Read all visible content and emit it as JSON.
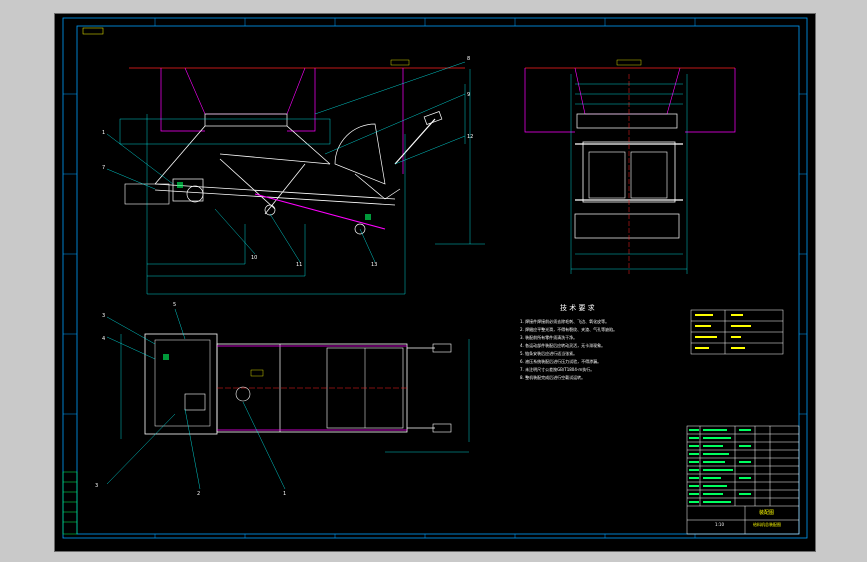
{
  "technical_requirements": {
    "title": "技 术 要 求",
    "lines": [
      "1. 焊接件焊接前必须去除毛刺、飞边、氧化皮等。",
      "2. 焊缝应平整光滑，不得有裂纹、夹渣、气孔等缺陷。",
      "3. 装配前所有零件须清洗干净。",
      "4. 各运动部件装配后应转动灵活，无卡滞现象。",
      "5. 链条安装后应进行适当张紧。",
      "6. 液压系统装配后进行压力试验，不得渗漏。",
      "7. 未注明尺寸公差按GB/T1804-m执行。",
      "8. 整机装配完成后进行空载试运转。"
    ]
  },
  "part_labels": [
    "1",
    "2",
    "3",
    "4",
    "5",
    "6",
    "7",
    "8",
    "9",
    "10",
    "11",
    "12",
    "13"
  ],
  "title_block": {
    "drawing_title": "装配图",
    "subtitle": "给料机总装配图",
    "scale": "1:10"
  },
  "colors": {
    "paper": "#000000",
    "frame": "#00a0ff",
    "body": "#ffffff",
    "hopper": "#ff00ff",
    "center_line": "#ff2020",
    "dimension": "#00ffff",
    "hatch": "#00ff60",
    "note": "#ffff00"
  }
}
